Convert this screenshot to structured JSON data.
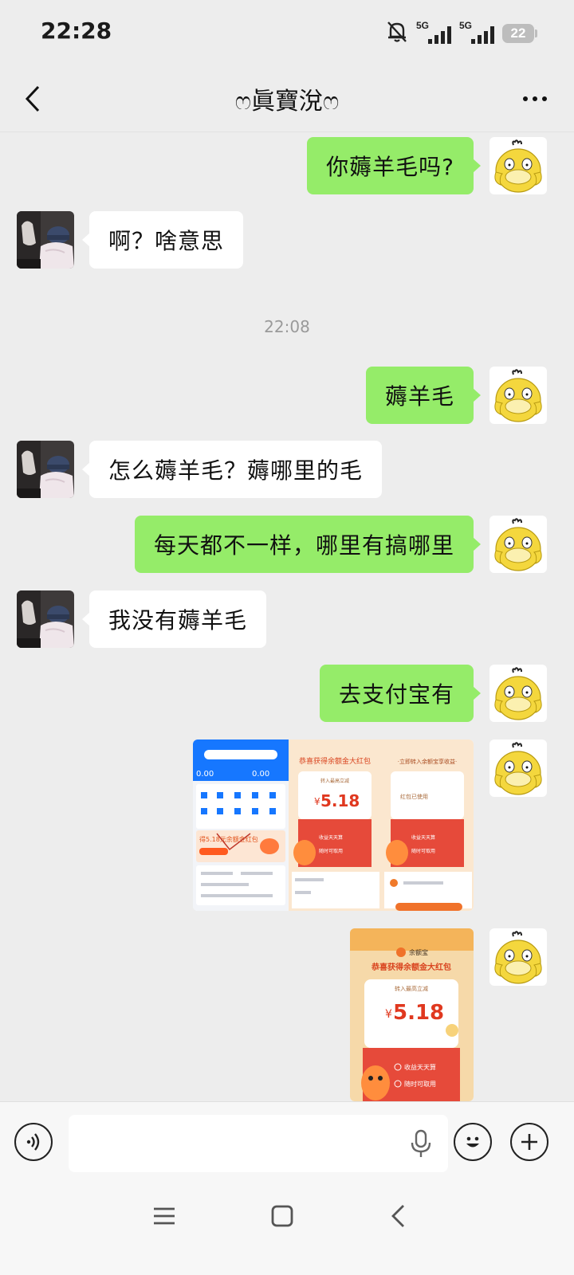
{
  "status_bar": {
    "time": "22:28",
    "icons": [
      "mute-bell-icon",
      "signal-icon",
      "signal-icon",
      "battery-icon"
    ],
    "signal_1_label": "5G",
    "signal_2_label": "5G",
    "battery_level": "22"
  },
  "header": {
    "title": "ෆ眞寶涗ෆ",
    "back_icon": "chevron-left-icon",
    "more_icon": "more-dots-icon"
  },
  "messages": [
    {
      "side": "right",
      "type": "text",
      "text": "你薅羊毛吗?"
    },
    {
      "side": "left",
      "type": "text",
      "text": "啊？啥意思"
    },
    {
      "type": "timestamp",
      "text": "22:08"
    },
    {
      "side": "right",
      "type": "text",
      "text": "薅羊毛"
    },
    {
      "side": "left",
      "type": "text",
      "text": "怎么薅羊毛？薅哪里的毛"
    },
    {
      "side": "right",
      "type": "text",
      "text": "每天都不一样，哪里有搞哪里"
    },
    {
      "side": "left",
      "type": "text",
      "text": "我没有薅羊毛"
    },
    {
      "side": "right",
      "type": "text",
      "text": "去支付宝有"
    },
    {
      "side": "right",
      "type": "image",
      "description_texts": {
        "amount": "5.18",
        "currency": "¥",
        "panel1_promo": "得5.18元余额金红包",
        "panel1_account_top": "0.00",
        "panel1_account_top2": "0.00",
        "panel2_title": "恭喜获得余额金大红包",
        "panel2_sub": "转入最高立减",
        "panel2_item1": "收益天天算",
        "panel2_item2": "随时可取用",
        "panel3_title": "·立即转入余额宝享收益·",
        "panel3_status": "红包已使用",
        "panel3_item1": "收益天天算",
        "panel3_item2": "随时可取用"
      }
    },
    {
      "side": "right",
      "type": "image",
      "description_texts": {
        "app_name": "余额宝",
        "title": "恭喜获得余额金大红包",
        "sub": "转入最高立减",
        "currency": "¥",
        "amount": "5.18",
        "item1": "收益天天算",
        "item2": "随时可取用"
      }
    }
  ],
  "input_bar": {
    "voice_icon": "voice-mode-icon",
    "mic_icon": "microphone-icon",
    "emoji_icon": "emoji-icon",
    "plus_icon": "plus-icon",
    "placeholder": ""
  },
  "nav_bar": {
    "icons": [
      "menu-icon",
      "home-square-icon",
      "back-nav-icon"
    ]
  },
  "colors": {
    "chat_bg": "#ededed",
    "bubble_right": "#95ec69",
    "bubble_left": "#ffffff",
    "psyduck_yellow": "#f4d73d"
  }
}
